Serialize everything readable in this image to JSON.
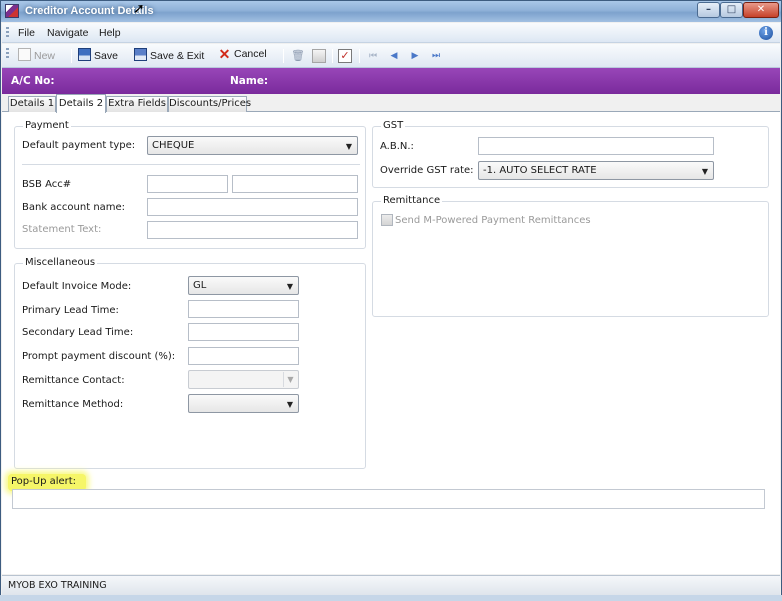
{
  "window": {
    "title": "Creditor Account Details",
    "controls": {
      "minimize": "–",
      "maximize": "□",
      "close": "✕"
    }
  },
  "menu": [
    "File",
    "Navigate",
    "Help"
  ],
  "toolbar": {
    "new_label": "New",
    "save_label": "Save",
    "save_exit_label": "Save & Exit",
    "cancel_label": "Cancel"
  },
  "header": {
    "ac_no_label": "A/C No:",
    "name_label": "Name:"
  },
  "tabs": [
    "Details 1",
    "Details 2",
    "Extra Fields",
    "Discounts/Prices"
  ],
  "active_tab": "Details 2",
  "payment": {
    "title": "Payment",
    "default_payment_type_label": "Default payment type:",
    "default_payment_type_value": "CHEQUE",
    "bsb_label": "BSB Acc#",
    "bsb_value": "",
    "acc_value": "",
    "bank_account_name_label": "Bank account name:",
    "bank_account_name_value": "",
    "statement_text_label": "Statement Text:",
    "statement_text_value": ""
  },
  "gst": {
    "title": "GST",
    "abn_label": "A.B.N.:",
    "abn_value": "",
    "override_label": "Override GST rate:",
    "override_value": "-1. AUTO SELECT RATE"
  },
  "remittance": {
    "title": "Remittance",
    "send_label": "Send M-Powered Payment Remittances",
    "send_checked": false
  },
  "misc": {
    "title": "Miscellaneous",
    "invoice_mode_label": "Default Invoice Mode:",
    "invoice_mode_value": "GL",
    "primary_lead_label": "Primary Lead Time:",
    "primary_lead_value": "",
    "secondary_lead_label": "Secondary Lead Time:",
    "secondary_lead_value": "",
    "prompt_discount_label": "Prompt payment discount (%):",
    "prompt_discount_value": "",
    "remit_contact_label": "Remittance Contact:",
    "remit_contact_value": "",
    "remit_method_label": "Remittance Method:",
    "remit_method_value": ""
  },
  "popup": {
    "label": "Pop-Up alert:",
    "value": ""
  },
  "status": {
    "text": "MYOB EXO TRAINING"
  },
  "colors": {
    "header_purple": "#8a3aac",
    "highlight_yellow": "#f6f668",
    "titlebar_blue": "#8fb1d8"
  },
  "icons": [
    "app-icon",
    "info-icon",
    "new-icon",
    "save-icon",
    "save-exit-icon",
    "cancel-icon",
    "delete-icon",
    "print-icon",
    "check-icon",
    "first-icon",
    "prev-icon",
    "next-icon",
    "last-icon"
  ]
}
